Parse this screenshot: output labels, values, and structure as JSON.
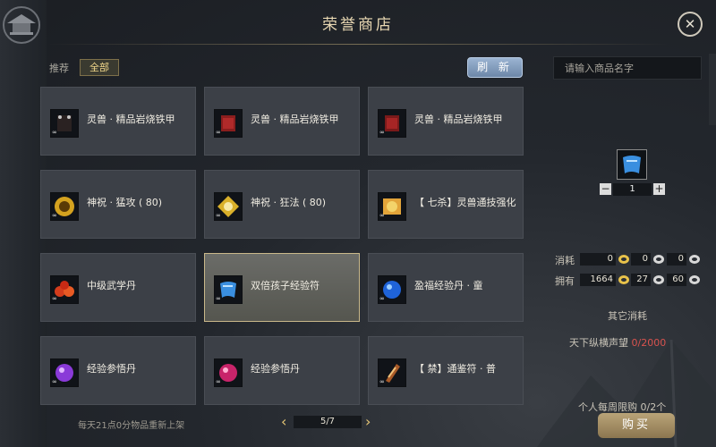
{
  "header": {
    "title": "荣誉商店"
  },
  "filters": {
    "recommend_label": "推荐",
    "all_label": "全部"
  },
  "refresh_label": "刷 新",
  "search": {
    "placeholder": "请输入商品名字"
  },
  "items": [
    {
      "name": "灵兽 · 精品岩烧铁甲",
      "icon": "armor-dark-icon",
      "quantity_tag": "∞"
    },
    {
      "name": "灵兽 · 精品岩烧铁甲",
      "icon": "armor-red-icon",
      "quantity_tag": "∞"
    },
    {
      "name": "灵兽 · 精品岩烧铁甲",
      "icon": "armor-red-icon",
      "quantity_tag": "∞"
    },
    {
      "name": "神祝 · 猛攻 ( 80)",
      "icon": "golden-mask-icon",
      "quantity_tag": "∞"
    },
    {
      "name": "神祝 · 狂法 ( 80)",
      "icon": "golden-wings-icon",
      "quantity_tag": "∞"
    },
    {
      "name": "【 七杀】灵兽通技强化",
      "icon": "beast-tome-icon",
      "quantity_tag": "∞"
    },
    {
      "name": "中级武学丹",
      "icon": "red-pills-icon",
      "quantity_tag": "∞"
    },
    {
      "name": "双倍孩子经验符",
      "icon": "blue-scroll-icon",
      "quantity_tag": "∞"
    },
    {
      "name": "盈福经验丹 · 童",
      "icon": "blue-orb-icon",
      "quantity_tag": "∞"
    },
    {
      "name": "经验参悟丹",
      "icon": "purple-orb-icon",
      "quantity_tag": "∞"
    },
    {
      "name": "经验参悟丹",
      "icon": "pink-orb-icon",
      "quantity_tag": "∞"
    },
    {
      "name": "【 禁】通鉴符 · 普",
      "icon": "talisman-icon",
      "quantity_tag": "∞"
    }
  ],
  "selected_index": 7,
  "detail": {
    "selected_icon": "blue-scroll-icon",
    "quantity": "1",
    "cost_label": "消耗",
    "own_label": "拥有",
    "cost_values": [
      "0",
      "0",
      "0"
    ],
    "own_values": [
      "1664",
      "27",
      "60"
    ],
    "other_cost_label": "其它消耗",
    "reputation_label": "天下纵横声望",
    "reputation_value": "0/2000",
    "weekly_limit": "个人每周限购 0/2个",
    "buy_label": "购买"
  },
  "footer": {
    "refresh_note": "每天21点0分物品重新上架",
    "page": "5/7"
  },
  "colors": {
    "gold_coin": "#e8c24a",
    "silver_coin": "#d8d8d8",
    "accent_gold": "#e8d7b2",
    "red_text": "#d9534f",
    "refresh_blue": "#7d96b8"
  }
}
